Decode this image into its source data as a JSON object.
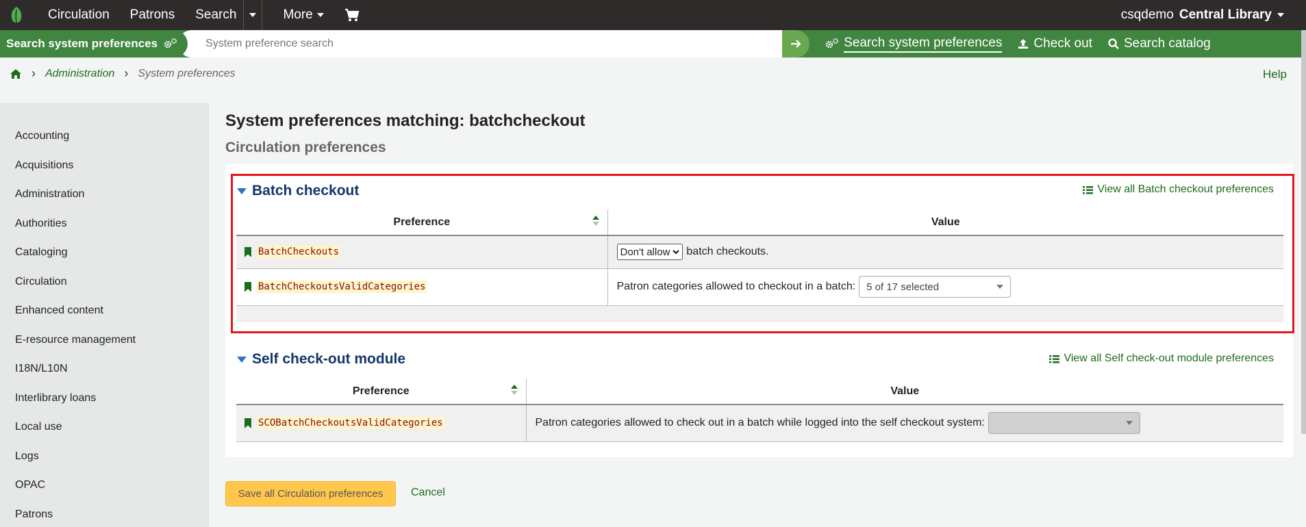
{
  "topnav": {
    "items": [
      "Circulation",
      "Patrons",
      "Search",
      "More"
    ],
    "user": "csqdemo",
    "library": "Central Library"
  },
  "searchbar": {
    "label": "Search system preferences",
    "placeholder": "System preference search",
    "links": [
      "Search system preferences",
      "Check out",
      "Search catalog"
    ]
  },
  "breadcrumb": {
    "items": [
      "Administration",
      "System preferences"
    ],
    "help": "Help"
  },
  "sidebar": {
    "items": [
      "Accounting",
      "Acquisitions",
      "Administration",
      "Authorities",
      "Cataloging",
      "Circulation",
      "Enhanced content",
      "E-resource management",
      "I18N/L10N",
      "Interlibrary loans",
      "Local use",
      "Logs",
      "OPAC",
      "Patrons"
    ]
  },
  "main": {
    "title": "System preferences matching: batchcheckout",
    "subtitle": "Circulation preferences",
    "columns": {
      "preference": "Preference",
      "value": "Value"
    },
    "sections": [
      {
        "title": "Batch checkout",
        "view_all": "View all Batch checkout preferences",
        "rows": [
          {
            "name": "BatchCheckouts",
            "select": "Don't allow",
            "suffix": "batch checkouts."
          },
          {
            "name": "BatchCheckoutsValidCategories",
            "prefix": "Patron categories allowed to checkout in a batch:",
            "multi": "5 of 17 selected"
          }
        ]
      },
      {
        "title": "Self check-out module",
        "view_all": "View all Self check-out module preferences",
        "rows": [
          {
            "name": "SCOBatchCheckoutsValidCategories",
            "prefix": "Patron categories allowed to check out in a batch while logged into the self checkout system:",
            "multi": ""
          }
        ]
      }
    ],
    "save_label": "Save all Circulation preferences",
    "cancel_label": "Cancel"
  }
}
